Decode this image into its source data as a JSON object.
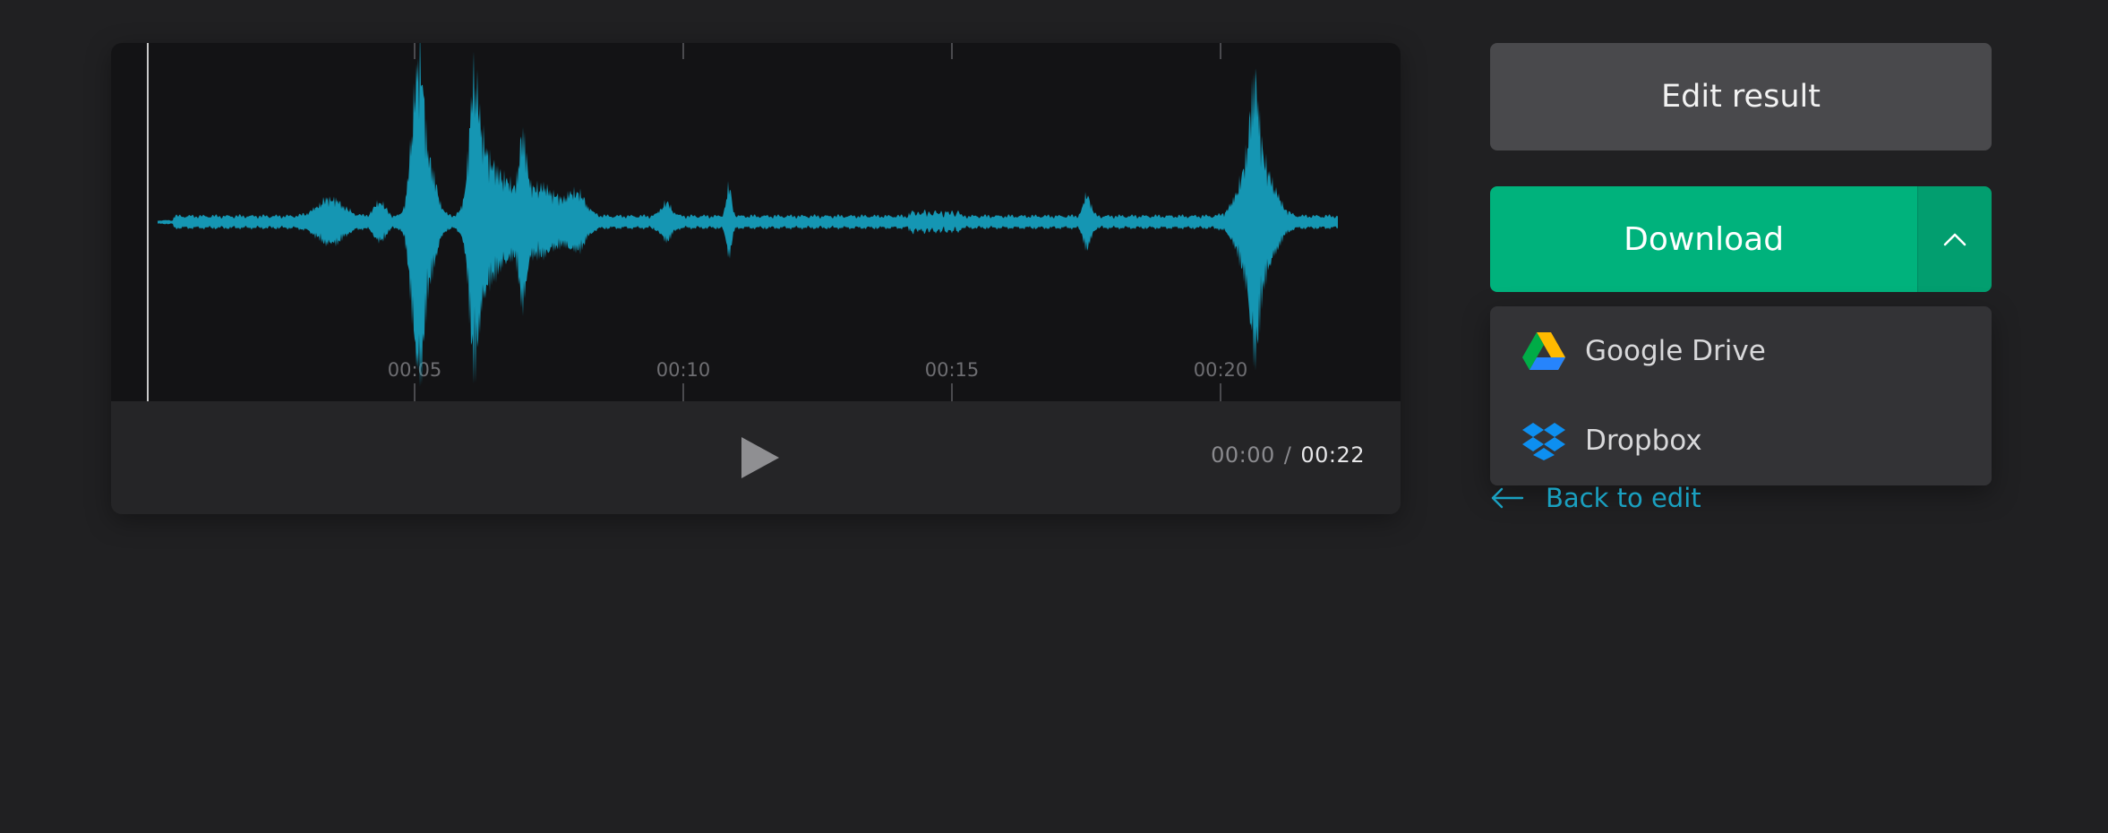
{
  "player": {
    "timeline_labels": [
      "00:05",
      "00:10",
      "00:15",
      "00:20"
    ],
    "current_time": "00:00",
    "separator": "/",
    "total_time": "00:22",
    "waveform_color": "#1596b3",
    "play_icon": "play-icon"
  },
  "actions": {
    "edit_label": "Edit result",
    "download_label": "Download",
    "download_color": "#00b27c",
    "chevron_icon": "chevron-up-icon"
  },
  "dropdown": {
    "items": [
      {
        "label": "Google Drive",
        "icon": "google-drive-icon"
      },
      {
        "label": "Dropbox",
        "icon": "dropbox-icon"
      }
    ]
  },
  "back": {
    "label": "Back to edit",
    "icon": "arrow-left-icon",
    "color": "#1aa0c0"
  }
}
